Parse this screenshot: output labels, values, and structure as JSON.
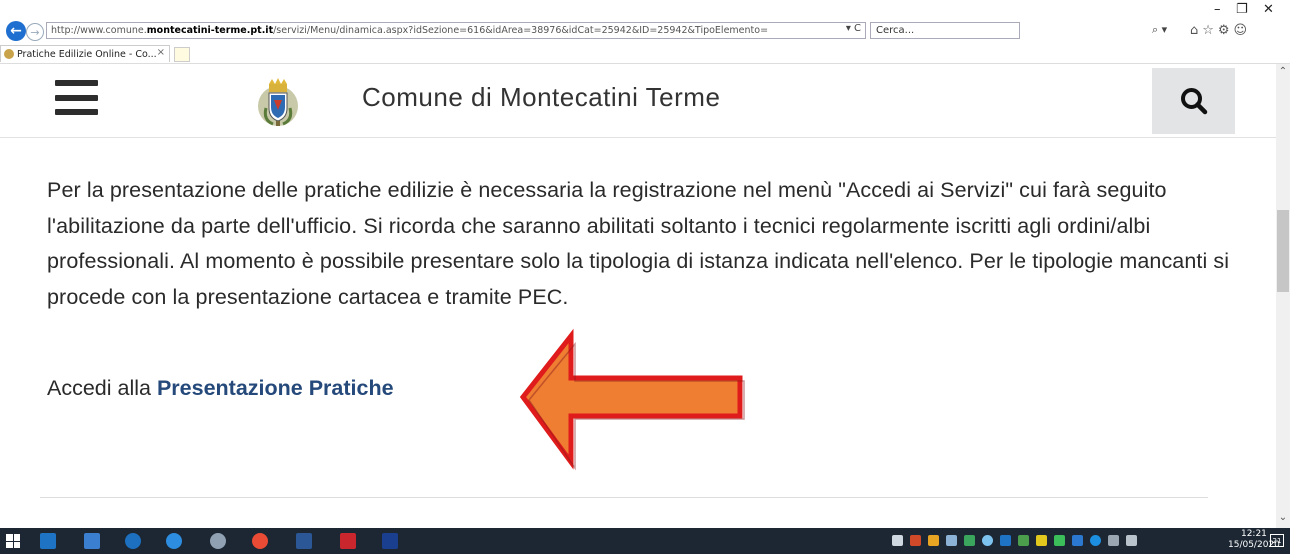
{
  "window": {
    "minimize": "–",
    "restore": "❐",
    "close": "✕"
  },
  "browser": {
    "url_prefix": "http://www.comune.",
    "url_domain": "montecatini-terme.pt.it",
    "url_path": "/servizi/Menu/dinamica.aspx?idSezione=616&idArea=38976&idCat=25942&ID=25942&TipoElemento=",
    "address_tools": "▾ C",
    "search_placeholder": "Cerca...",
    "search_dropdown": "⌕ ▾",
    "toolbar_icons": "⌂☆⚙☺",
    "tab_title": "Pratiche Edilizie Online - Co...",
    "tab_close": "×"
  },
  "header": {
    "site_title": "Comune di Montecatini Terme"
  },
  "content": {
    "intro": "Per la presentazione delle pratiche edilizie è necessaria la registrazione nel menù \"Accedi ai Servizi\" cui farà seguito l'abilitazione da parte dell'ufficio. Si ricorda che saranno abilitati soltanto i tecnici regolarmente iscritti agli ordini/albi professionali. Al momento è possibile presentare solo la tipologia di istanza indicata nell'elenco. Per le tipologie mancanti si procede con la presentazione cartacea e tramite PEC.",
    "access_prefix": "Accedi alla ",
    "access_link": "Presentazione Pratiche"
  },
  "scrollbar": {
    "up": "⌃",
    "down": "⌄"
  },
  "taskbar": {
    "time": "12:21",
    "date": "15/05/2020",
    "notifications": "21"
  },
  "colors": {
    "link": "#24497a",
    "arrow_fill": "#ef7d32",
    "arrow_stroke": "#e01b1b",
    "taskbar": "#1c2733"
  }
}
